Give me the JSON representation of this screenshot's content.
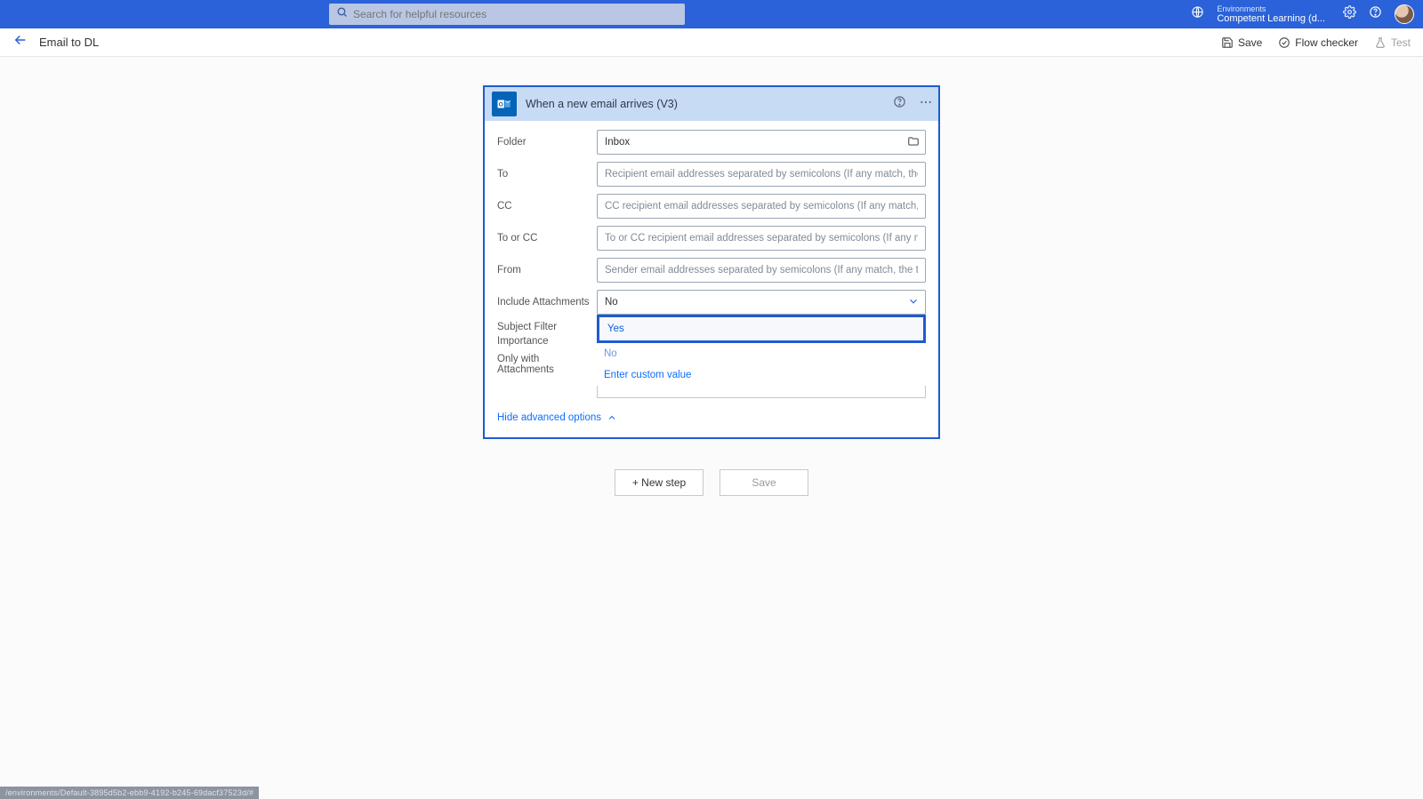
{
  "header": {
    "search_placeholder": "Search for helpful resources",
    "env_label": "Environments",
    "env_name": "Competent Learning (d..."
  },
  "toolbar": {
    "flow_title": "Email to DL",
    "save_label": "Save",
    "flow_checker_label": "Flow checker",
    "test_label": "Test"
  },
  "card": {
    "title": "When a new email arrives (V3)",
    "fields": {
      "folder_label": "Folder",
      "folder_value": "Inbox",
      "to_label": "To",
      "to_placeholder": "Recipient email addresses separated by semicolons (If any match, the",
      "cc_label": "CC",
      "cc_placeholder": "CC recipient email addresses separated by semicolons (If any match,",
      "toorcc_label": "To or CC",
      "toorcc_placeholder": "To or CC recipient email addresses separated by semicolons (If any m",
      "from_label": "From",
      "from_placeholder": "Sender email addresses separated by semicolons (If any match, the t",
      "include_attachments_label": "Include Attachments",
      "include_attachments_value": "No",
      "subject_filter_label": "Subject Filter",
      "importance_label": "Importance",
      "only_attachments_label": "Only with Attachments"
    },
    "dropdown": {
      "option_yes": "Yes",
      "option_no": "No",
      "option_custom": "Enter custom value"
    },
    "advanced_link": "Hide advanced options"
  },
  "actions": {
    "new_step": "+ New step",
    "save": "Save"
  },
  "status_bar_text": "/environments/Default-3895d5b2-ebb9-4192-b245-69dacf37523d/#"
}
